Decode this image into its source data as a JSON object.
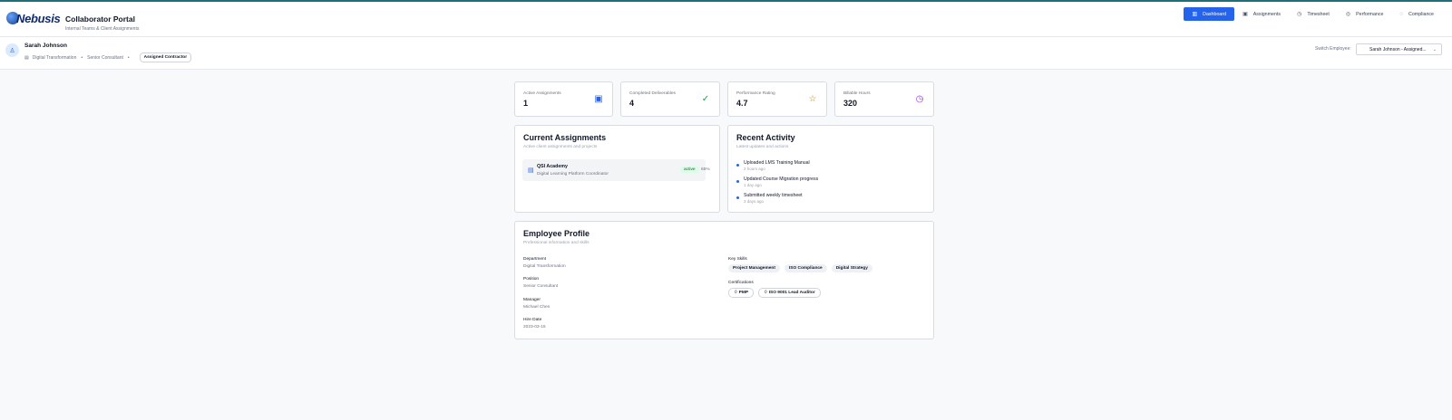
{
  "header": {
    "logo_text": "Nebusis",
    "title": "Collaborator Portal",
    "subtitle": "Internal Teams & Client Assignments",
    "nav": [
      {
        "label": "Dashboard",
        "icon": "chart-icon",
        "active": true
      },
      {
        "label": "Assignments",
        "icon": "briefcase-icon",
        "active": false
      },
      {
        "label": "Timesheet",
        "icon": "clock-icon",
        "active": false
      },
      {
        "label": "Performance",
        "icon": "target-icon",
        "active": false
      },
      {
        "label": "Compliance",
        "icon": "circle-check-icon",
        "active": false
      }
    ]
  },
  "employee": {
    "name": "Sarah Johnson",
    "department": "Digital Transformation",
    "position": "Senior Consultant",
    "badge": "Assigned Contractor",
    "switch_label": "Switch Employee:",
    "switch_value": "Sarah Johnson - Assigned..."
  },
  "stats": [
    {
      "label": "Active Assignments",
      "value": "1",
      "icon": "briefcase-icon",
      "color": "#2563eb"
    },
    {
      "label": "Completed Deliverables",
      "value": "4",
      "icon": "check-circle-icon",
      "color": "#16a34a"
    },
    {
      "label": "Performance Rating",
      "value": "4.7",
      "icon": "star-icon",
      "color": "#ca8a04"
    },
    {
      "label": "Billable Hours",
      "value": "320",
      "icon": "clock-icon",
      "color": "#9333ea"
    }
  ],
  "assignments": {
    "title": "Current Assignments",
    "subtitle": "Active client assignments and projects",
    "items": [
      {
        "client": "QSI Academy",
        "role": "Digital Learning Platform Coordinator",
        "status": "active",
        "progress": "65%"
      }
    ]
  },
  "activity": {
    "title": "Recent Activity",
    "subtitle": "Latest updates and actions",
    "items": [
      {
        "title": "Uploaded LMS Training Manual",
        "time": "2 hours ago"
      },
      {
        "title": "Updated Course Migration progress",
        "time": "1 day ago"
      },
      {
        "title": "Submitted weekly timesheet",
        "time": "3 days ago"
      }
    ]
  },
  "profile": {
    "title": "Employee Profile",
    "subtitle": "Professional information and skills",
    "fields": [
      {
        "label": "Department",
        "value": "Digital Transformation"
      },
      {
        "label": "Position",
        "value": "Senior Consultant"
      },
      {
        "label": "Manager",
        "value": "Michael Chen"
      },
      {
        "label": "Hire Date",
        "value": "2023-03-15"
      }
    ],
    "skills_label": "Key Skills",
    "skills": [
      "Project Management",
      "ISO Compliance",
      "Digital Strategy"
    ],
    "certs_label": "Certifications",
    "certs": [
      "PMP",
      "ISO 9001 Lead Auditor"
    ]
  },
  "colors": {
    "accent": "#2563eb",
    "status_active_bg": "#dcfce7",
    "status_active_text": "#166534"
  }
}
